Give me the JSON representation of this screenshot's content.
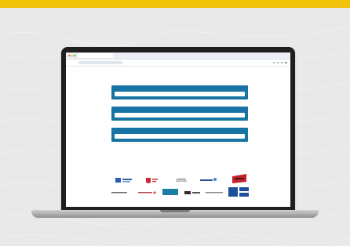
{
  "colors": {
    "accent_bar": "#f3c20a",
    "form_panel": "#1673a3",
    "card_bg": "#e9e9e9"
  },
  "browser": {
    "tab_title": "",
    "url": ""
  },
  "form": {
    "fields": [
      {
        "label": "",
        "value": ""
      },
      {
        "label": "",
        "value": ""
      },
      {
        "label": "",
        "value": ""
      }
    ]
  },
  "logos": {
    "row1": [
      "",
      "",
      "",
      "",
      ""
    ],
    "row2": [
      "",
      "",
      "",
      "",
      "",
      ""
    ]
  }
}
